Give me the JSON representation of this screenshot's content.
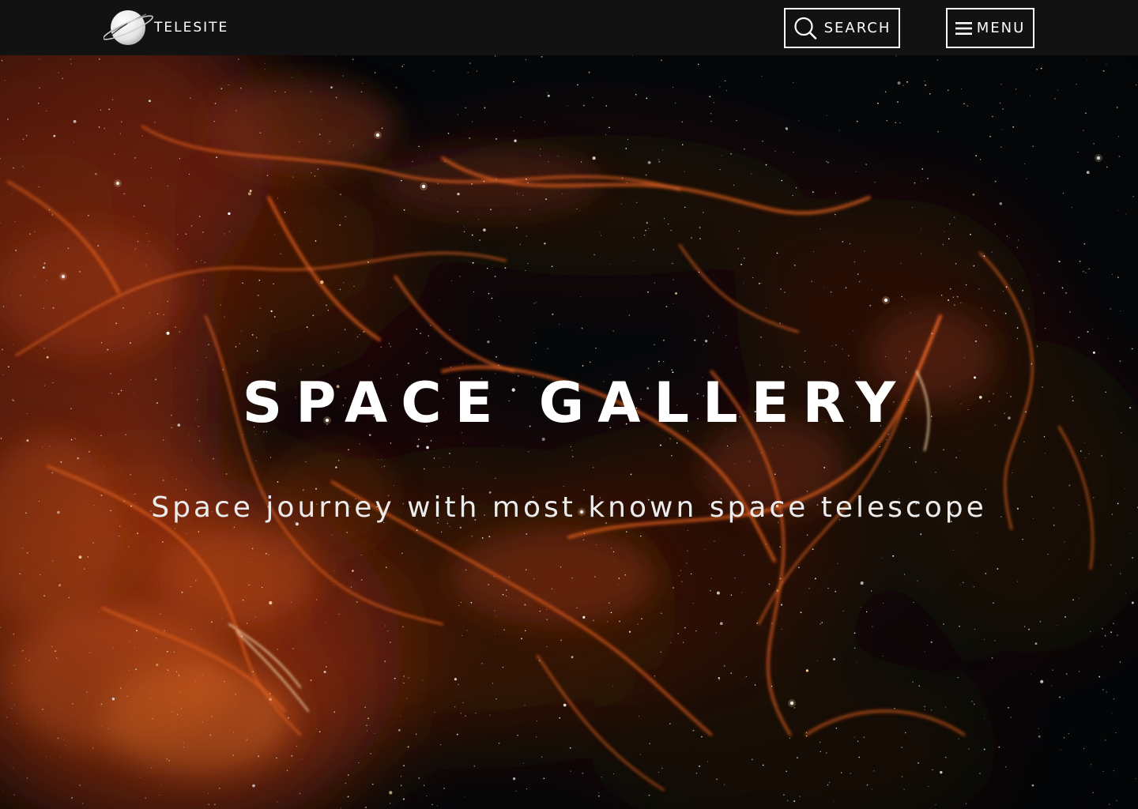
{
  "site": {
    "brand_name": "TELESITE",
    "logo_icon": "planet-ring-icon"
  },
  "nav": {
    "search": {
      "label": "SEARCH",
      "icon": "search-icon"
    },
    "menu": {
      "label": "MENU",
      "icon": "hamburger-icon"
    }
  },
  "hero": {
    "title": "SPACE GALLERY",
    "subtitle": "Space journey with most known space telescope",
    "background": "nebula-starfield-image"
  },
  "colors": {
    "navbar": "#121212",
    "text": "#ffffff",
    "nebula": "#e0561c",
    "space": "#050608"
  }
}
